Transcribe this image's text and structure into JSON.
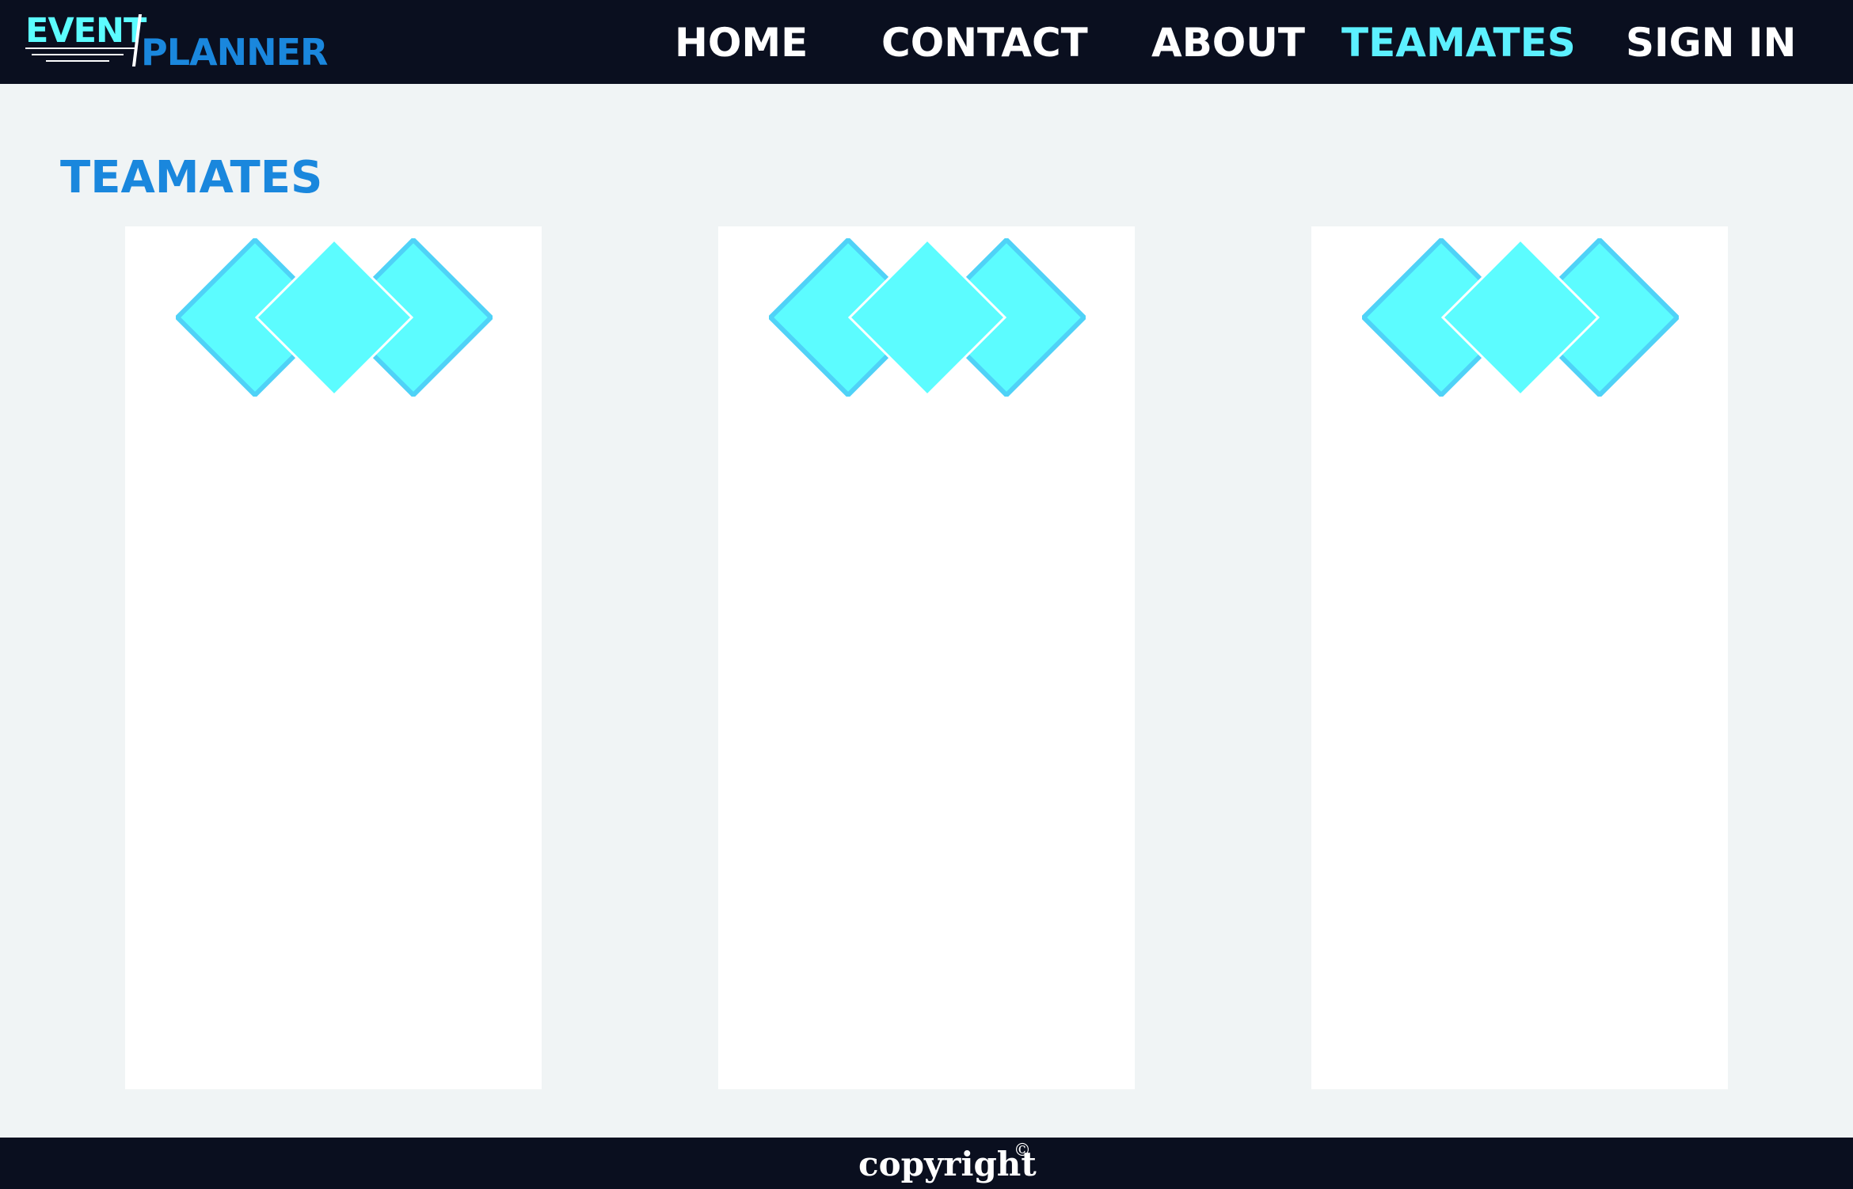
{
  "header": {
    "logo": {
      "word1": "EVENT",
      "word2": "PLANNER"
    },
    "nav": {
      "home": "HOME",
      "contact": "CONTACT",
      "about": "ABOUT",
      "teamates": "TEAMATES",
      "sign_in": "SIGN IN"
    },
    "active_item": "teamates"
  },
  "main": {
    "title": "TEAMATES",
    "cards": [
      {
        "emblem_icon": "diamond-cluster-icon"
      },
      {
        "emblem_icon": "diamond-cluster-icon"
      },
      {
        "emblem_icon": "diamond-cluster-icon"
      }
    ]
  },
  "footer": {
    "text": "copyright",
    "icon": "copyright-icon",
    "icon_glyph": "©"
  },
  "colors": {
    "nav_bg": "#0a0f1f",
    "page_bg": "#f0f4f5",
    "brand_blue": "#1a87dd",
    "accent_cyan": "#5cfcff",
    "diamond_edge": "#4fd2f7"
  }
}
